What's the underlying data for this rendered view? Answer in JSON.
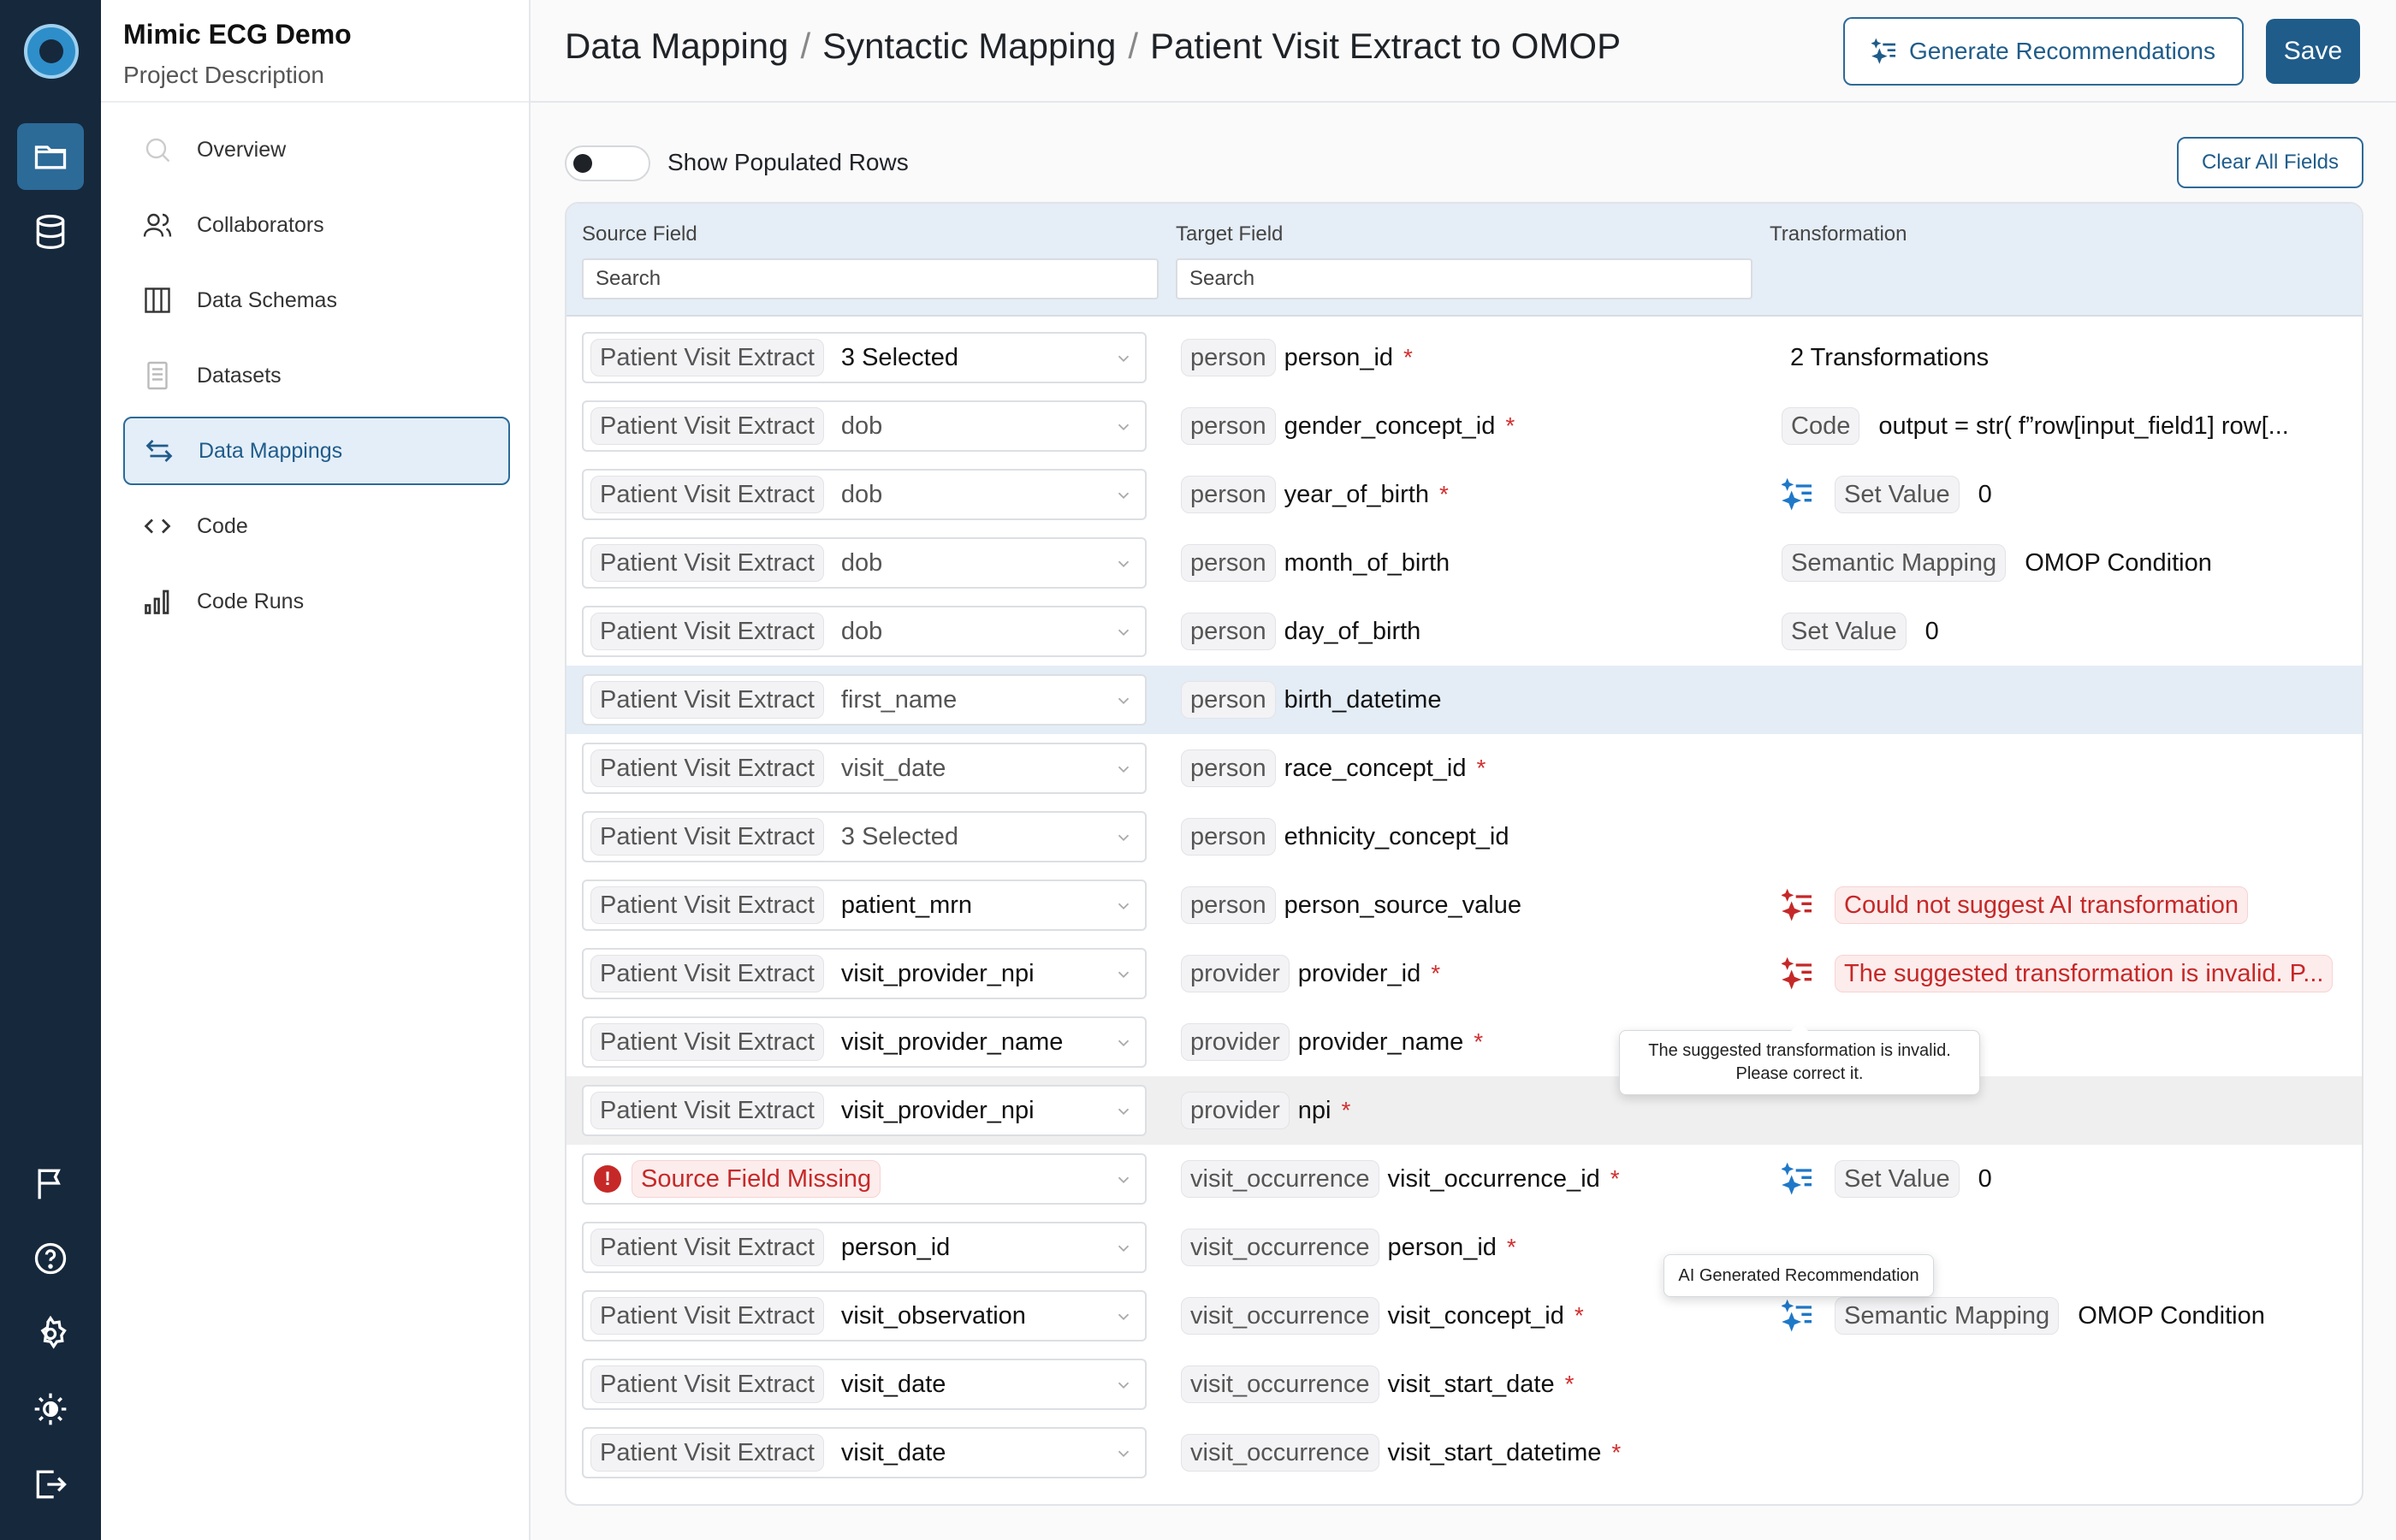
{
  "project": {
    "name": "Mimic ECG Demo",
    "description": "Project Description"
  },
  "nav": [
    {
      "label": "Overview",
      "icon": "search-icon"
    },
    {
      "label": "Collaborators",
      "icon": "users-icon"
    },
    {
      "label": "Data Schemas",
      "icon": "columns-icon"
    },
    {
      "label": "Datasets",
      "icon": "document-icon"
    },
    {
      "label": "Data Mappings",
      "icon": "arrows-swap-icon",
      "active": true
    },
    {
      "label": "Code",
      "icon": "code-icon"
    },
    {
      "label": "Code Runs",
      "icon": "bar-chart-icon"
    }
  ],
  "header": {
    "breadcrumb": [
      "Data Mapping",
      "Syntactic Mapping",
      "Patient Visit Extract to OMOP"
    ],
    "separator": "/",
    "generate_label": "Generate Recommendations",
    "save_label": "Save"
  },
  "toolbar": {
    "toggle_label": "Show Populated Rows",
    "clear_label": "Clear All Fields"
  },
  "table": {
    "headers": {
      "source": "Source Field",
      "target": "Target Field",
      "transformation": "Transformation"
    },
    "search_placeholder": "Search",
    "rows": [
      {
        "src_table": "Patient Visit Extract",
        "src_field": "3 Selected",
        "tgt_table": "person",
        "tgt_field": "person_id",
        "required": true,
        "trans_plain": "2 Transformations"
      },
      {
        "src_table": "Patient Visit Extract",
        "src_field": "dob",
        "src_muted": true,
        "tgt_table": "person",
        "tgt_field": "gender_concept_id",
        "required": true,
        "trans_chip": "Code",
        "trans_text": "output = str( f”row[input_field1] row[..."
      },
      {
        "src_table": "Patient Visit Extract",
        "src_field": "dob",
        "src_muted": true,
        "tgt_table": "person",
        "tgt_field": "year_of_birth",
        "required": true,
        "ai_icon": "blue",
        "trans_chip": "Set Value",
        "trans_text": "0"
      },
      {
        "src_table": "Patient Visit Extract",
        "src_field": "dob",
        "src_muted": true,
        "tgt_table": "person",
        "tgt_field": "month_of_birth",
        "trans_chip": "Semantic Mapping",
        "trans_text": "OMOP Condition"
      },
      {
        "src_table": "Patient Visit Extract",
        "src_field": "dob",
        "src_muted": true,
        "tgt_table": "person",
        "tgt_field": "day_of_birth",
        "trans_chip": "Set Value",
        "trans_text": "0"
      },
      {
        "src_table": "Patient Visit Extract",
        "src_field": "first_name",
        "src_muted": true,
        "tgt_table": "person",
        "tgt_field": "birth_datetime",
        "highlight": true
      },
      {
        "src_table": "Patient Visit Extract",
        "src_field": "visit_date",
        "src_muted": true,
        "tgt_table": "person",
        "tgt_field": "race_concept_id",
        "required": true
      },
      {
        "src_table": "Patient Visit Extract",
        "src_field": "3 Selected",
        "src_muted": true,
        "tgt_table": "person",
        "tgt_field": "ethnicity_concept_id"
      },
      {
        "src_table": "Patient Visit Extract",
        "src_field": "patient_mrn",
        "tgt_table": "person",
        "tgt_field": "person_source_value",
        "ai_icon": "red",
        "trans_error": "Could not suggest AI transformation"
      },
      {
        "src_table": "Patient Visit Extract",
        "src_field": "visit_provider_npi",
        "tgt_table": "provider",
        "tgt_field": "provider_id",
        "required": true,
        "ai_icon": "red",
        "trans_error": "The suggested transformation is invalid. P..."
      },
      {
        "src_table": "Patient Visit Extract",
        "src_field": "visit_provider_name",
        "tgt_table": "provider",
        "tgt_field": "provider_name",
        "required": true
      },
      {
        "src_table": "Patient Visit Extract",
        "src_field": "visit_provider_npi",
        "tgt_table": "provider",
        "tgt_field": "npi",
        "required": true,
        "gray": true
      },
      {
        "src_missing": "Source Field Missing",
        "tgt_table": "visit_occurrence",
        "tgt_field": "visit_occurrence_id",
        "required": true,
        "ai_icon": "blue",
        "trans_chip": "Set Value",
        "trans_text": "0"
      },
      {
        "src_table": "Patient Visit Extract",
        "src_field": "person_id",
        "tgt_table": "visit_occurrence",
        "tgt_field": "person_id",
        "required": true
      },
      {
        "src_table": "Patient Visit Extract",
        "src_field": "visit_observation",
        "tgt_table": "visit_occurrence",
        "tgt_field": "visit_concept_id",
        "required": true,
        "ai_icon": "blue",
        "trans_chip": "Semantic Mapping",
        "trans_text": "OMOP Condition"
      },
      {
        "src_table": "Patient Visit Extract",
        "src_field": "visit_date",
        "tgt_table": "visit_occurrence",
        "tgt_field": "visit_start_date",
        "required": true
      },
      {
        "src_table": "Patient Visit Extract",
        "src_field": "visit_date",
        "tgt_table": "visit_occurrence",
        "tgt_field": "visit_start_datetime",
        "required": true
      }
    ]
  },
  "tooltips": {
    "invalid": [
      "The suggested transformation is invalid.",
      "Please correct it."
    ],
    "ai": "AI Generated Recommendation"
  },
  "colors": {
    "accent": "#1f5c8a",
    "rail": "#16283c",
    "error": "#c62828",
    "required": "#d32f2f",
    "highlight_row": "#e4edf6"
  }
}
